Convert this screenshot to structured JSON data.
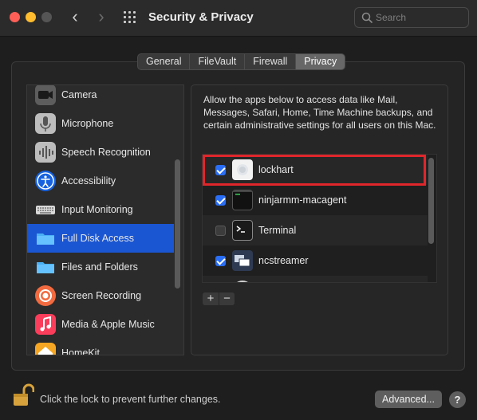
{
  "window": {
    "title": "Security & Privacy"
  },
  "search": {
    "placeholder": "Search"
  },
  "tabs": [
    {
      "label": "General",
      "active": false
    },
    {
      "label": "FileVault",
      "active": false
    },
    {
      "label": "Firewall",
      "active": false
    },
    {
      "label": "Privacy",
      "active": true
    }
  ],
  "sidebar": {
    "items": [
      {
        "label": "Camera",
        "icon": "camera-icon"
      },
      {
        "label": "Microphone",
        "icon": "microphone-icon"
      },
      {
        "label": "Speech Recognition",
        "icon": "speech-recognition-icon"
      },
      {
        "label": "Accessibility",
        "icon": "accessibility-icon"
      },
      {
        "label": "Input Monitoring",
        "icon": "keyboard-icon"
      },
      {
        "label": "Full Disk Access",
        "icon": "folder-icon",
        "selected": true
      },
      {
        "label": "Files and Folders",
        "icon": "folder-icon"
      },
      {
        "label": "Screen Recording",
        "icon": "screen-recording-icon"
      },
      {
        "label": "Media & Apple Music",
        "icon": "music-icon"
      },
      {
        "label": "HomeKit",
        "icon": "homekit-icon"
      }
    ]
  },
  "main": {
    "description": "Allow the apps below to access data like Mail, Messages, Safari, Home, Time Machine backups, and certain administrative settings for all users on this Mac.",
    "apps": [
      {
        "name": "lockhart",
        "checked": true,
        "icon": "lockhart-app-icon"
      },
      {
        "name": "ninjarmm-macagent",
        "checked": true,
        "icon": "terminal-exec-icon"
      },
      {
        "name": "Terminal",
        "checked": false,
        "icon": "terminal-icon"
      },
      {
        "name": "ncstreamer",
        "checked": true,
        "icon": "ncstreamer-icon"
      }
    ],
    "add_label": "+",
    "remove_label": "−"
  },
  "footer": {
    "lock_text": "Click the lock to prevent further changes.",
    "advanced_label": "Advanced...",
    "help_label": "?"
  },
  "colors": {
    "selection": "#1b56d2",
    "checkbox": "#2a6ef5",
    "highlight_box": "#e0262b"
  }
}
